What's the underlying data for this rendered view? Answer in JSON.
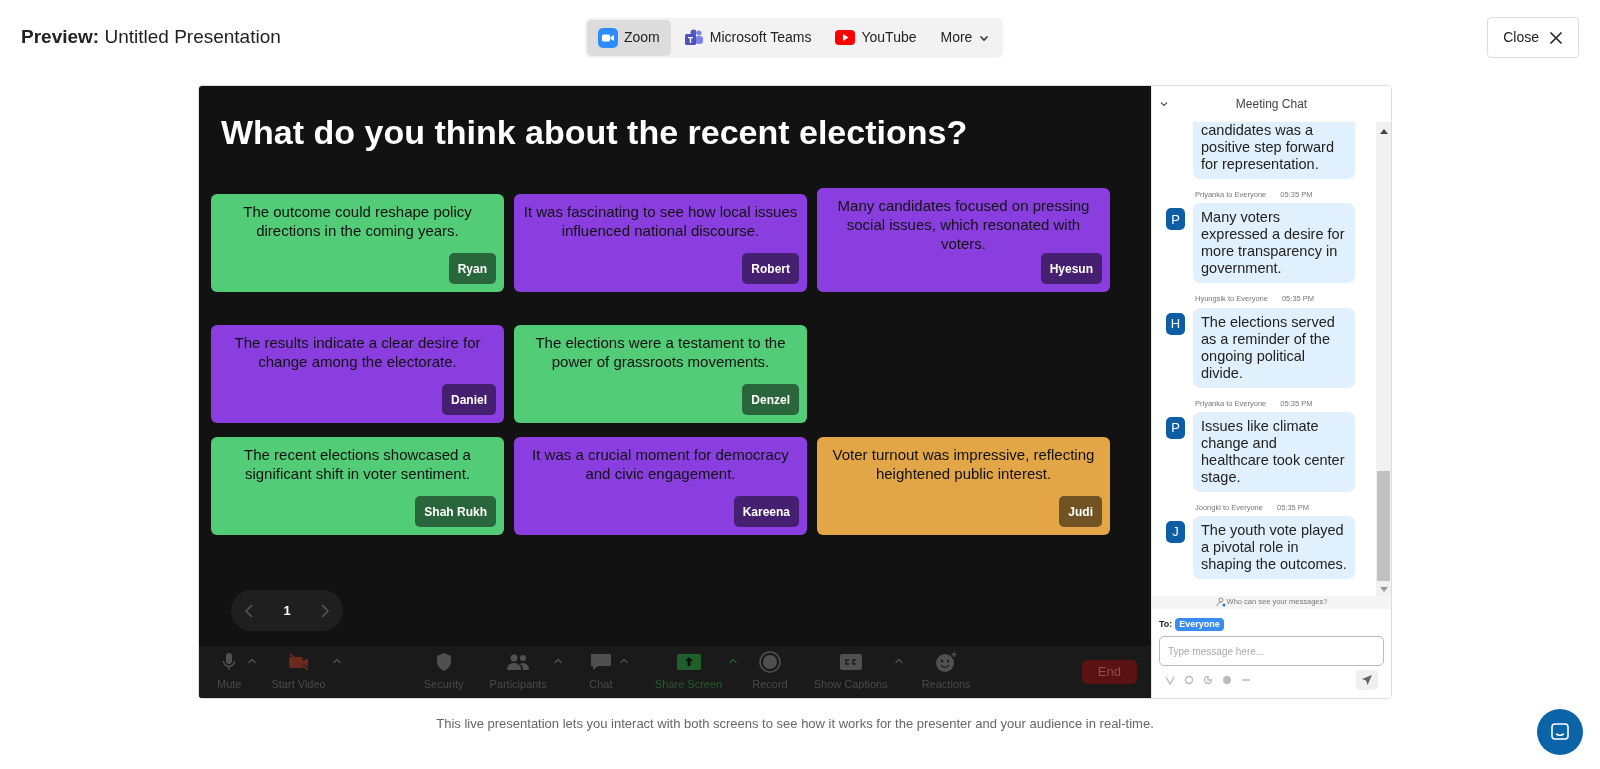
{
  "header": {
    "title": "**Preview:** Untitled Presentation",
    "platform_tabs": [
      {
        "label": "Zoom",
        "kind": "zoom",
        "selected": true
      },
      {
        "label": "Microsoft Teams",
        "kind": "teams",
        "selected": false
      },
      {
        "label": "YouTube",
        "kind": "youtube",
        "selected": false
      },
      {
        "label": "More",
        "kind": "more",
        "selected": false
      }
    ],
    "close_button": "Close"
  },
  "slide": {
    "question": "What do you think about the recent elections?",
    "card_rows": [
      [
        {
          "text": "The outcome could reshape policy directions in the coming years.",
          "author": "Ryan",
          "color": "#52cc77"
        },
        {
          "text": "It was fascinating to see how local issues influenced national discourse.",
          "author": "Robert",
          "color": "#8a3ee0"
        },
        {
          "text": "Many candidates focused on pressing social issues, which resonated with voters.",
          "author": "Hyesun",
          "color": "#8a3ee0"
        }
      ],
      [
        {
          "text": "The results indicate a clear desire for change among the electorate.",
          "author": "Daniel",
          "color": "#8a3ee0"
        },
        {
          "text": "The elections were a testament to the power of grassroots movements.",
          "author": "Denzel",
          "color": "#52cc77"
        }
      ],
      [
        {
          "text": "The recent elections showcased a significant shift in voter sentiment.",
          "author": "Shah Rukh",
          "color": "#52cc77"
        },
        {
          "text": "It was a crucial moment for democracy and civic engagement.",
          "author": "Kareena",
          "color": "#8a3ee0"
        },
        {
          "text": "Voter turnout was impressive, reflecting heightened public interest.",
          "author": "Judi",
          "color": "#e3a646"
        }
      ]
    ],
    "page": "1"
  },
  "meeting_toolbar": {
    "items": [
      {
        "label": "Mute",
        "kind": "mic",
        "menu": true
      },
      {
        "label": "Start Video",
        "kind": "video",
        "menu": true
      },
      {
        "label": "Security",
        "kind": "shield",
        "menu": false
      },
      {
        "label": "Participants",
        "kind": "people",
        "menu": true
      },
      {
        "label": "Chat",
        "kind": "chat",
        "menu": true
      },
      {
        "label": "Share Screen",
        "kind": "share",
        "menu": true
      },
      {
        "label": "Record",
        "kind": "record",
        "menu": false
      },
      {
        "label": "Show Captions",
        "kind": "captions",
        "menu": true
      },
      {
        "label": "Reactions",
        "kind": "reactions",
        "menu": false
      }
    ],
    "end_button": "End"
  },
  "chat": {
    "title": "Meeting Chat",
    "messages": [
      {
        "text": "candidates was a positive step forward for representation."
      },
      {
        "sender": "Priyanka to Everyone",
        "time": "05:35 PM",
        "initial": "P",
        "text": "Many voters expressed a desire for more transparency in government."
      },
      {
        "sender": "Hyungsik to Everyone",
        "time": "05:35 PM",
        "initial": "H",
        "text": "The elections served as a reminder of the ongoing political divide."
      },
      {
        "sender": "Priyanka to Everyone",
        "time": "05:35 PM",
        "initial": "P",
        "text": "Issues like climate change and healthcare took center stage."
      },
      {
        "sender": "Joongki to Everyone",
        "time": "05:35 PM",
        "initial": "J",
        "text": "The youth vote played a pivotal role in shaping the outcomes."
      }
    ],
    "privacy_note": "Who can see your messages?",
    "to_label": "To:",
    "recipient": "Everyone",
    "placeholder": "Type message here..."
  },
  "caption": "This live presentation lets you interact with both screens to see how it works for the presenter and your audience in real-time."
}
